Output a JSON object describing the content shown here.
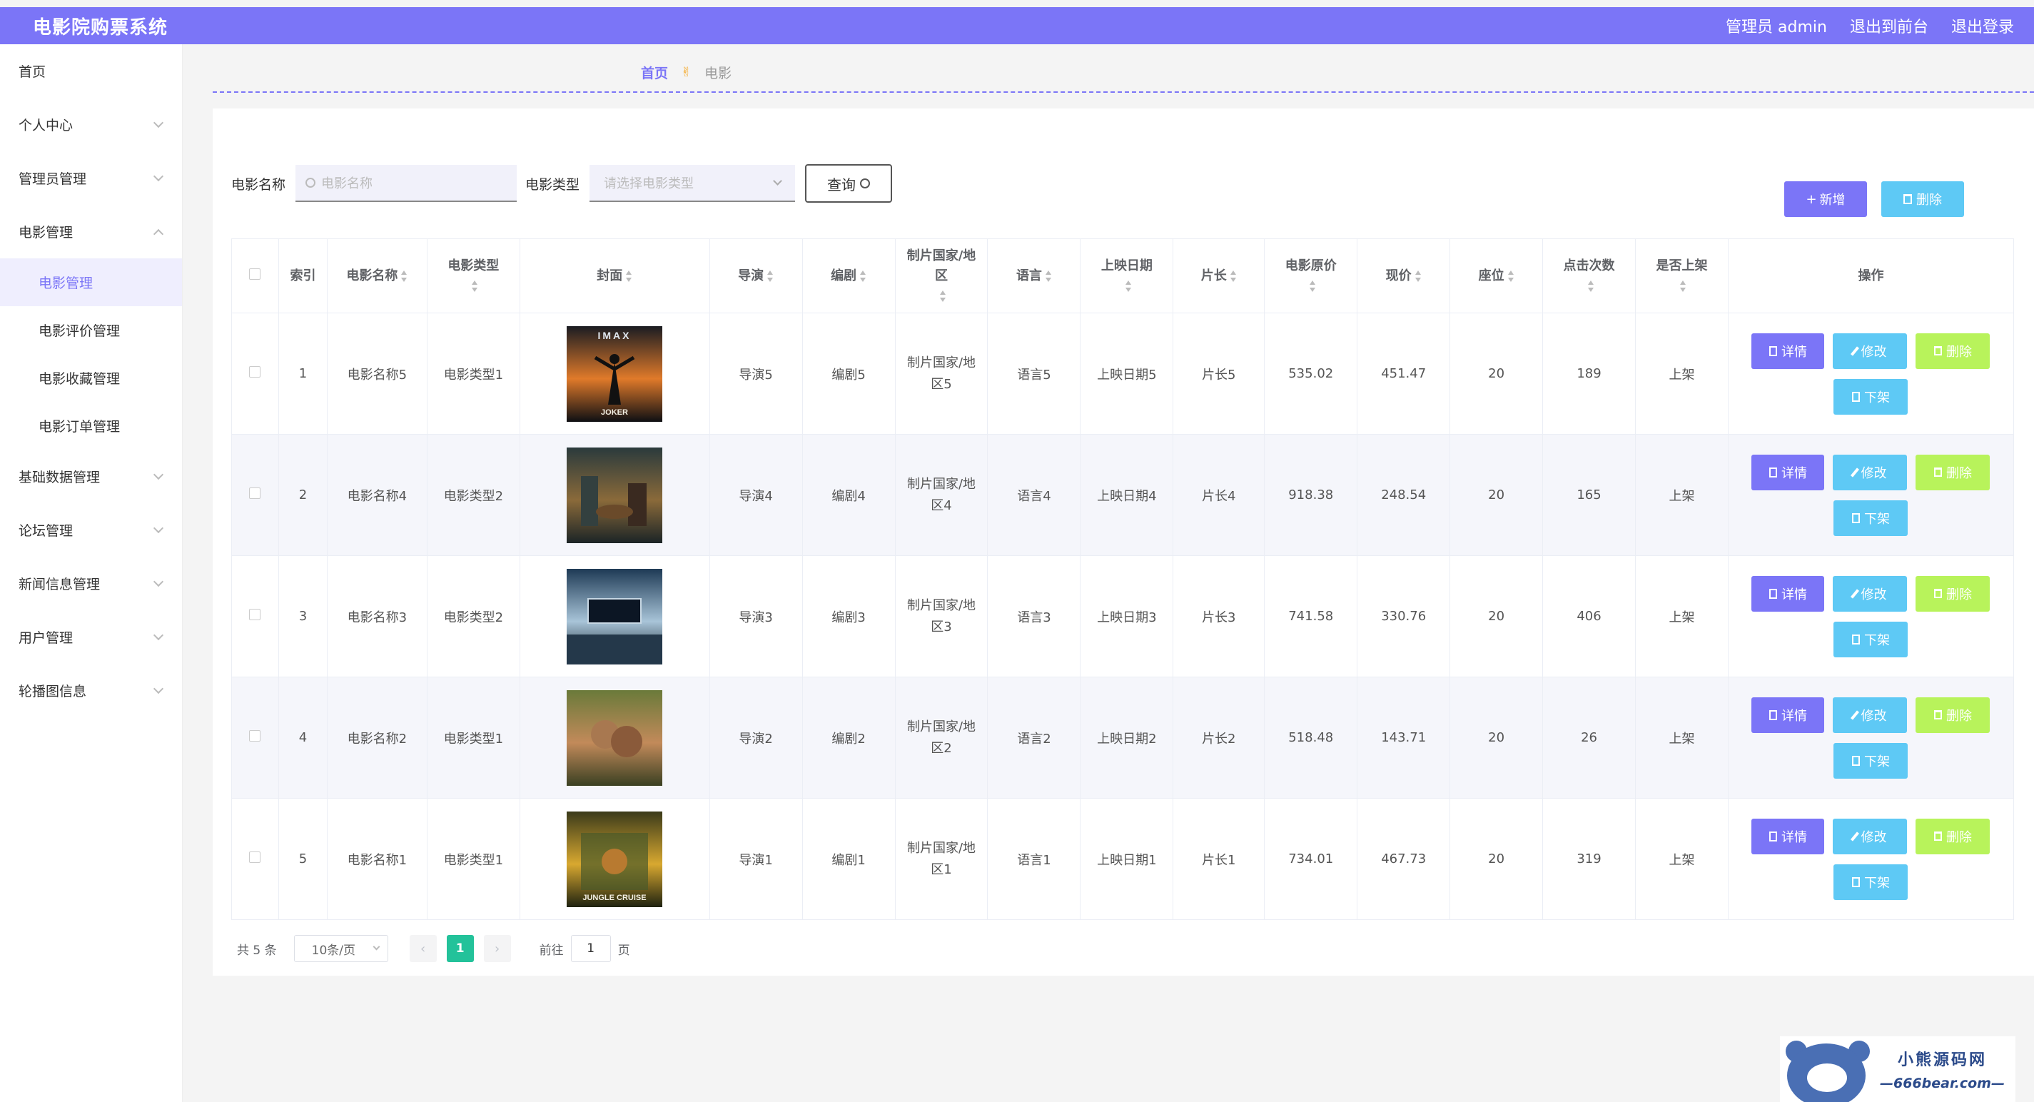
{
  "app": {
    "title": "电影院购票系统",
    "user": "管理员 admin",
    "to_front": "退出到前台",
    "logout": "退出登录"
  },
  "sidebar": {
    "items": [
      {
        "label": "首页",
        "expandable": false
      },
      {
        "label": "个人中心",
        "expandable": true
      },
      {
        "label": "管理员管理",
        "expandable": true
      },
      {
        "label": "电影管理",
        "expandable": true,
        "expanded": true
      },
      {
        "label": "基础数据管理",
        "expandable": true
      },
      {
        "label": "论坛管理",
        "expandable": true
      },
      {
        "label": "新闻信息管理",
        "expandable": true
      },
      {
        "label": "用户管理",
        "expandable": true
      },
      {
        "label": "轮播图信息",
        "expandable": true
      }
    ],
    "subitems": [
      "电影管理",
      "电影评价管理",
      "电影收藏管理",
      "电影订单管理"
    ],
    "active_subitem": "电影管理"
  },
  "breadcrumb": {
    "home": "首页",
    "current": "电影"
  },
  "search": {
    "name_label": "电影名称",
    "name_placeholder": "电影名称",
    "type_label": "电影类型",
    "type_placeholder": "请选择电影类型",
    "query_button": "查询"
  },
  "actions": {
    "add": "新增",
    "delete": "删除"
  },
  "table": {
    "headers": [
      "索引",
      "电影名称",
      "电影类型",
      "封面",
      "导演",
      "编剧",
      "制片国家/地区",
      "语言",
      "上映日期",
      "片长",
      "电影原价",
      "现价",
      "座位",
      "点击次数",
      "是否上架",
      "操作"
    ],
    "rows": [
      {
        "index": "1",
        "name": "电影名称5",
        "type": "电影类型1",
        "director": "导演5",
        "writer": "编剧5",
        "country": "制片国家/地区5",
        "language": "语言5",
        "release": "上映日期5",
        "length": "片长5",
        "orig_price": "535.02",
        "price": "451.47",
        "seats": "20",
        "clicks": "189",
        "on_shelf": "上架"
      },
      {
        "index": "2",
        "name": "电影名称4",
        "type": "电影类型2",
        "director": "导演4",
        "writer": "编剧4",
        "country": "制片国家/地区4",
        "language": "语言4",
        "release": "上映日期4",
        "length": "片长4",
        "orig_price": "918.38",
        "price": "248.54",
        "seats": "20",
        "clicks": "165",
        "on_shelf": "上架"
      },
      {
        "index": "3",
        "name": "电影名称3",
        "type": "电影类型2",
        "director": "导演3",
        "writer": "编剧3",
        "country": "制片国家/地区3",
        "language": "语言3",
        "release": "上映日期3",
        "length": "片长3",
        "orig_price": "741.58",
        "price": "330.76",
        "seats": "20",
        "clicks": "406",
        "on_shelf": "上架"
      },
      {
        "index": "4",
        "name": "电影名称2",
        "type": "电影类型1",
        "director": "导演2",
        "writer": "编剧2",
        "country": "制片国家/地区2",
        "language": "语言2",
        "release": "上映日期2",
        "length": "片长2",
        "orig_price": "518.48",
        "price": "143.71",
        "seats": "20",
        "clicks": "26",
        "on_shelf": "上架"
      },
      {
        "index": "5",
        "name": "电影名称1",
        "type": "电影类型1",
        "director": "导演1",
        "writer": "编剧1",
        "country": "制片国家/地区1",
        "language": "语言1",
        "release": "上映日期1",
        "length": "片长1",
        "orig_price": "734.01",
        "price": "467.73",
        "seats": "20",
        "clicks": "319",
        "on_shelf": "上架"
      }
    ],
    "row_actions": {
      "detail": "详情",
      "edit": "修改",
      "remove": "删除",
      "shelf": "下架"
    }
  },
  "posters": {
    "1": {
      "top_text": "IMAX",
      "bottom_text": "JOKER"
    },
    "5": {
      "bottom_text": "JUNGLE CRUISE"
    }
  },
  "pager": {
    "total": "共 5 条",
    "page_size": "10条/页",
    "prev": "‹",
    "next": "›",
    "current": "1",
    "goto_label": "前往",
    "goto_value": "1",
    "page_unit": "页"
  },
  "watermark": {
    "cn": "小熊源码网",
    "en": "—666bear.com—"
  },
  "colors": {
    "primary": "#7b75f7",
    "info": "#5ec9f5",
    "success": "#b8f35b",
    "pager_active": "#23c29a"
  }
}
